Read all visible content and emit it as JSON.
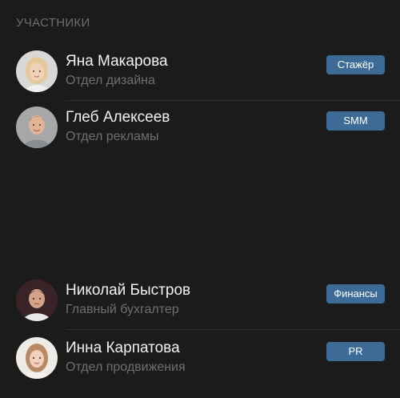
{
  "section": {
    "title": "УЧАСТНИКИ"
  },
  "members": [
    {
      "name": "Яна Макарова",
      "department": "Отдел дизайна",
      "role": "Стажёр",
      "avatar_icon": "woman-blonde-avatar"
    },
    {
      "name": "Глеб Алексеев",
      "department": "Отдел рекламы",
      "role": "SMM",
      "avatar_icon": "man-ginger-avatar"
    },
    {
      "name": "Николай Быстров",
      "department": "Главный бухгалтер",
      "role": "Финансы",
      "avatar_icon": "man-dark-avatar"
    },
    {
      "name": "Инна Карпатова",
      "department": "Отдел продвижения",
      "role": "PR",
      "avatar_icon": "woman-light-brown-avatar"
    }
  ],
  "colors": {
    "background": "#1b1b1b",
    "badge": "#3c6b97",
    "name_text": "#f2f2f2",
    "secondary_text": "#6f6f6f"
  }
}
